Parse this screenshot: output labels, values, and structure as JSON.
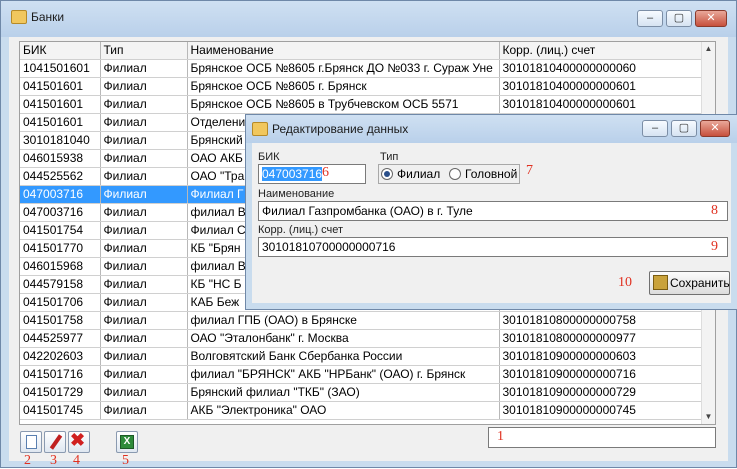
{
  "window": {
    "title": "Банки",
    "minimize": "–",
    "maximize": "▢",
    "close": "✕"
  },
  "grid": {
    "headers": [
      "БИК",
      "Тип",
      "Наименование",
      "Корр. (лиц.) счет"
    ],
    "rows": [
      [
        "1041501601",
        "Филиал",
        "Брянское ОСБ №8605  г.Брянск ДО №033 г. Сураж Уне",
        "30101810400000000060"
      ],
      [
        "041501601",
        "Филиал",
        "Брянское ОСБ №8605 г. Брянск",
        "30101810400000000601"
      ],
      [
        "041501601",
        "Филиал",
        "Брянское ОСБ №8605 в Трубчевском ОСБ 5571",
        "30101810400000000601"
      ],
      [
        "041501601",
        "Филиал",
        "Отделени",
        ""
      ],
      [
        "3010181040",
        "Филиал",
        "Брянский",
        ""
      ],
      [
        "046015938",
        "Филиал",
        "ОАО АКБ",
        ""
      ],
      [
        "044525562",
        "Филиал",
        "ОАО \"Тра",
        ""
      ],
      [
        "047003716",
        "Филиал",
        "Филиал Г",
        ""
      ],
      [
        "047003716",
        "Филиал",
        "филиал В",
        ""
      ],
      [
        "041501754",
        "Филиал",
        "Филиал С",
        ""
      ],
      [
        "041501770",
        "Филиал",
        "КБ \"Брян",
        ""
      ],
      [
        "046015968",
        "Филиал",
        "филиал В",
        ""
      ],
      [
        "044579158",
        "Филиал",
        "КБ \"НС Б",
        ""
      ],
      [
        "041501706",
        "Филиал",
        "КАБ Беж",
        ""
      ],
      [
        "041501758",
        "Филиал",
        "филиал ГПБ (ОАО) в Брянске",
        "30101810800000000758"
      ],
      [
        "044525977",
        "Филиал",
        "ОАО \"Эталонбанк\" г. Москва",
        "30101810800000000977"
      ],
      [
        "042202603",
        "Филиал",
        "Волговятский Банк Сбербанка России",
        "30101810900000000603"
      ],
      [
        "041501716",
        "Филиал",
        "филиал \"БРЯНСК\" АКБ \"НРБанк\" (ОАО) г. Брянск",
        "30101810900000000716"
      ],
      [
        "041501729",
        "Филиал",
        "Брянский филиал \"ТКБ\" (ЗАО)",
        "30101810900000000729"
      ],
      [
        "041501745",
        "Филиал",
        "АКБ \"Электроника\" ОАО",
        "30101810900000000745"
      ]
    ]
  },
  "scroll": {
    "up": "▲",
    "down": "▼"
  },
  "markers": {
    "n1": "1",
    "n2": "2",
    "n3": "3",
    "n4": "4",
    "n5": "5",
    "n6": "6",
    "n7": "7",
    "n8": "8",
    "n9": "9",
    "n10": "10"
  },
  "dialog": {
    "title": "Редактирование данных",
    "bik_label": "БИК",
    "bik_value": "047003716",
    "type_label": "Тип",
    "type_branch": "Филиал",
    "type_head": "Головной",
    "name_label": "Наименование",
    "name_value": "Филиал Газпромбанка (ОАО) в г. Туле",
    "account_label": "Корр. (лиц.) счет",
    "account_value": "30101810700000000716",
    "save_label": "Сохранить"
  },
  "colors": {
    "selection": "#3399ff",
    "marker": "#e03020"
  }
}
